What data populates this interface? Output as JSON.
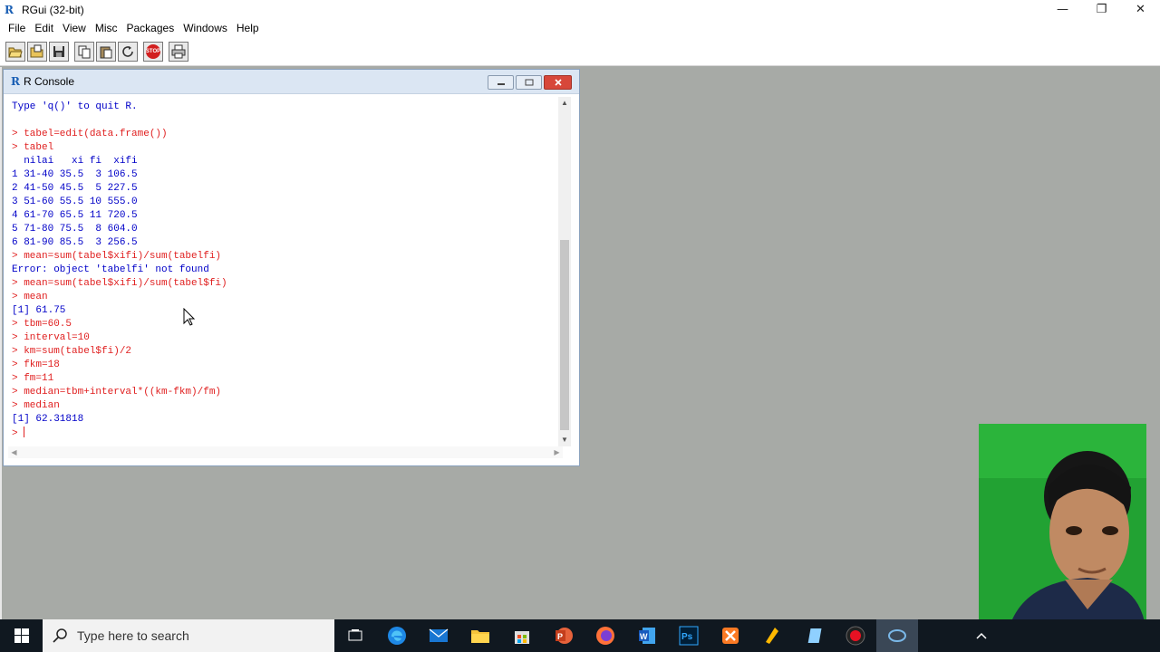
{
  "app": {
    "title": "RGui (32-bit)"
  },
  "window_controls": {
    "minimize": "—",
    "restore": "❐",
    "close": "✕"
  },
  "menu": [
    "File",
    "Edit",
    "View",
    "Misc",
    "Packages",
    "Windows",
    "Help"
  ],
  "toolbar": {
    "buttons": [
      "open-script-icon",
      "load-workspace-icon",
      "save-workspace-icon",
      "copy-icon",
      "paste-icon",
      "refresh-icon",
      "stop-icon",
      "print-icon"
    ],
    "stop_text": "STOP"
  },
  "console": {
    "title": "R Console",
    "lines": [
      {
        "t": "Type 'q()' to quit R.",
        "c": "blue"
      },
      {
        "t": "",
        "c": "blue"
      },
      {
        "t": "> tabel=edit(data.frame())",
        "c": "red"
      },
      {
        "t": "> tabel",
        "c": "red"
      },
      {
        "t": "  nilai   xi fi  xifi",
        "c": "blue"
      },
      {
        "t": "1 31-40 35.5  3 106.5",
        "c": "blue"
      },
      {
        "t": "2 41-50 45.5  5 227.5",
        "c": "blue"
      },
      {
        "t": "3 51-60 55.5 10 555.0",
        "c": "blue"
      },
      {
        "t": "4 61-70 65.5 11 720.5",
        "c": "blue"
      },
      {
        "t": "5 71-80 75.5  8 604.0",
        "c": "blue"
      },
      {
        "t": "6 81-90 85.5  3 256.5",
        "c": "blue"
      },
      {
        "t": "> mean=sum(tabel$xifi)/sum(tabelfi)",
        "c": "red"
      },
      {
        "t": "Error: object 'tabelfi' not found",
        "c": "blue"
      },
      {
        "t": "> mean=sum(tabel$xifi)/sum(tabel$fi)",
        "c": "red"
      },
      {
        "t": "> mean",
        "c": "red"
      },
      {
        "t": "[1] 61.75",
        "c": "blue"
      },
      {
        "t": "> tbm=60.5",
        "c": "red"
      },
      {
        "t": "> interval=10",
        "c": "red"
      },
      {
        "t": "> km=sum(tabel$fi)/2",
        "c": "red"
      },
      {
        "t": "> fkm=18",
        "c": "red"
      },
      {
        "t": "> fm=11",
        "c": "red"
      },
      {
        "t": "> median=tbm+interval*((km-fkm)/fm)",
        "c": "red"
      },
      {
        "t": "> median",
        "c": "red"
      },
      {
        "t": "[1] 62.31818",
        "c": "blue"
      }
    ],
    "prompt": "> "
  },
  "taskbar": {
    "search_placeholder": "Type here to search",
    "apps": [
      "task-view-icon",
      "edge-icon",
      "mail-icon",
      "file-explorer-icon",
      "store-icon",
      "powerpoint-icon",
      "firefox-icon",
      "word-icon",
      "photoshop-icon",
      "app-orange-icon",
      "app-yellow-icon",
      "notepad-icon",
      "recorder-icon",
      "cortana-app-icon"
    ]
  },
  "colors": {
    "prompt_red": "#e02020",
    "output_blue": "#0000c8",
    "titlebar_blue": "#dbe6f3"
  }
}
